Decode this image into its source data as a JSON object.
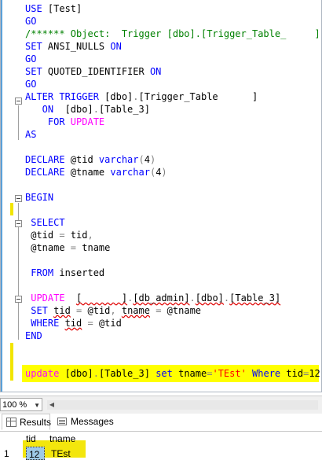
{
  "editor": {
    "lines": [
      [
        {
          "t": "USE ",
          "c": "kw"
        },
        {
          "t": "[Test]",
          "c": "plain"
        }
      ],
      [
        {
          "t": "GO",
          "c": "kw"
        }
      ],
      [
        {
          "t": "/****** Object:  Trigger [dbo].[Trigger_Table_     ]",
          "c": "cmt"
        }
      ],
      [
        {
          "t": "SET ",
          "c": "kw"
        },
        {
          "t": "ANSI_NULLS ",
          "c": "plain"
        },
        {
          "t": "ON",
          "c": "kw"
        }
      ],
      [
        {
          "t": "GO",
          "c": "kw"
        }
      ],
      [
        {
          "t": "SET ",
          "c": "kw"
        },
        {
          "t": "QUOTED_IDENTIFIER ",
          "c": "plain"
        },
        {
          "t": "ON",
          "c": "kw"
        }
      ],
      [
        {
          "t": "GO",
          "c": "kw"
        }
      ],
      [
        {
          "t": "ALTER TRIGGER ",
          "c": "kw"
        },
        {
          "t": "[dbo]",
          "c": "plain"
        },
        {
          "t": ".",
          "c": "op"
        },
        {
          "t": "[Trigger_Table      ]",
          "c": "plain"
        }
      ],
      [
        {
          "t": "   ON  ",
          "c": "kw"
        },
        {
          "t": "[dbo]",
          "c": "plain"
        },
        {
          "t": ".",
          "c": "op"
        },
        {
          "t": "[Table_3]",
          "c": "plain"
        }
      ],
      [
        {
          "t": "    FOR ",
          "c": "kw"
        },
        {
          "t": "UPDATE",
          "c": "fn"
        }
      ],
      [
        {
          "t": "AS",
          "c": "kw"
        }
      ],
      [],
      [
        {
          "t": "DECLARE ",
          "c": "kw"
        },
        {
          "t": "@tid ",
          "c": "plain"
        },
        {
          "t": "varchar",
          "c": "kw"
        },
        {
          "t": "(",
          "c": "op"
        },
        {
          "t": "4",
          "c": "plain"
        },
        {
          "t": ")",
          "c": "op"
        }
      ],
      [
        {
          "t": "DECLARE ",
          "c": "kw"
        },
        {
          "t": "@tname ",
          "c": "plain"
        },
        {
          "t": "varchar",
          "c": "kw"
        },
        {
          "t": "(",
          "c": "op"
        },
        {
          "t": "4",
          "c": "plain"
        },
        {
          "t": ")",
          "c": "op"
        }
      ],
      [],
      [
        {
          "t": "BEGIN",
          "c": "kw"
        }
      ],
      [],
      [
        {
          "t": " SELECT",
          "c": "kw"
        }
      ],
      [
        {
          "t": " @tid ",
          "c": "plain"
        },
        {
          "t": "=",
          "c": "op"
        },
        {
          "t": " tid",
          "c": "plain"
        },
        {
          "t": ",",
          "c": "op"
        }
      ],
      [
        {
          "t": " @tname ",
          "c": "plain"
        },
        {
          "t": "=",
          "c": "op"
        },
        {
          "t": " tname",
          "c": "plain"
        }
      ],
      [],
      [
        {
          "t": " FROM ",
          "c": "kw"
        },
        {
          "t": "inserted",
          "c": "plain"
        }
      ],
      [],
      [
        {
          "t": " UPDATE  ",
          "c": "fn"
        },
        {
          "t": "[       ]",
          "c": "plain sq"
        },
        {
          "t": ".",
          "c": "op"
        },
        {
          "t": "[db_admin]",
          "c": "plain sq"
        },
        {
          "t": ".",
          "c": "op"
        },
        {
          "t": "[dbo]",
          "c": "plain sq"
        },
        {
          "t": ".",
          "c": "op"
        },
        {
          "t": "[Table_3]",
          "c": "plain sq"
        }
      ],
      [
        {
          "t": " SET ",
          "c": "kw"
        },
        {
          "t": "tid",
          "c": "plain sq"
        },
        {
          "t": " = ",
          "c": "op"
        },
        {
          "t": "@tid",
          "c": "plain"
        },
        {
          "t": ", ",
          "c": "op"
        },
        {
          "t": "tname",
          "c": "plain sq"
        },
        {
          "t": " = ",
          "c": "op"
        },
        {
          "t": "@tname",
          "c": "plain"
        }
      ],
      [
        {
          "t": " WHERE ",
          "c": "kw"
        },
        {
          "t": "tid",
          "c": "plain sq"
        },
        {
          "t": " = ",
          "c": "op"
        },
        {
          "t": "@tid",
          "c": "plain"
        }
      ],
      [
        {
          "t": "END",
          "c": "kw"
        }
      ],
      [],
      [],
      [
        {
          "t": "update ",
          "c": "fn"
        },
        {
          "t": "[dbo]",
          "c": "plain"
        },
        {
          "t": ".",
          "c": "op"
        },
        {
          "t": "[Table_3] ",
          "c": "plain"
        },
        {
          "t": "set ",
          "c": "kw"
        },
        {
          "t": "tname",
          "c": "plain"
        },
        {
          "t": "=",
          "c": "op"
        },
        {
          "t": "'TEst'",
          "c": "str"
        },
        {
          "t": " Where ",
          "c": "kw"
        },
        {
          "t": "tid",
          "c": "plain"
        },
        {
          "t": "=",
          "c": "op"
        },
        {
          "t": "12",
          "c": "plain"
        }
      ]
    ]
  },
  "status": {
    "zoom": "100 %"
  },
  "tabs": [
    {
      "label": "Results",
      "active": true,
      "icon": "results-grid-icon"
    },
    {
      "label": "Messages",
      "active": false,
      "icon": "messages-icon"
    }
  ],
  "grid": {
    "columns": [
      "tid",
      "tname"
    ],
    "rows": [
      {
        "num": "1",
        "cells": [
          "12",
          "TEst"
        ]
      }
    ]
  },
  "colors": {
    "highlight": "#ffff00",
    "keyword": "#0000ff",
    "function": "#ff00ff",
    "comment": "#008000",
    "string": "#ff0000"
  }
}
